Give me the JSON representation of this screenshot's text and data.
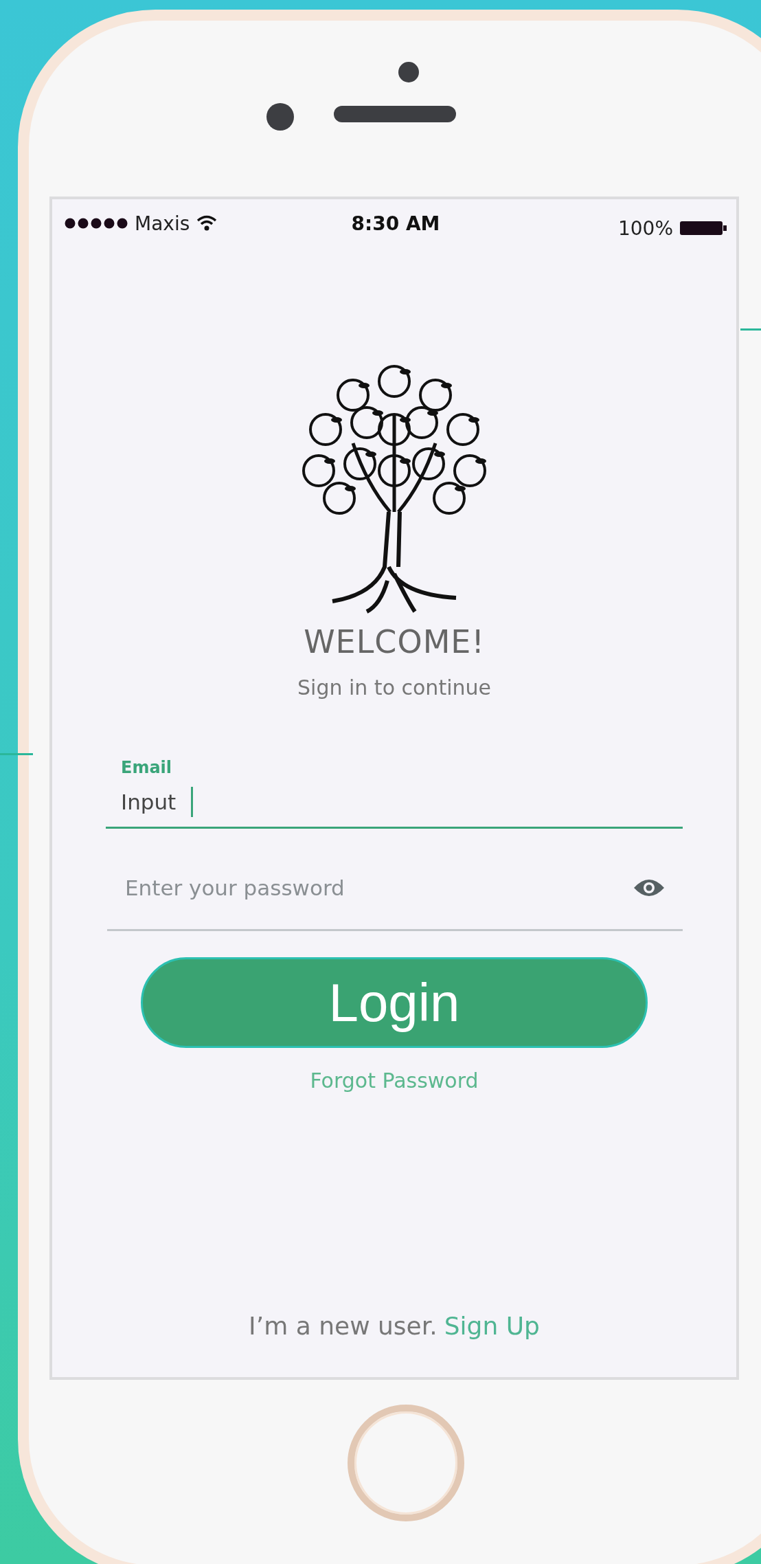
{
  "status_bar": {
    "carrier": "Maxis",
    "time": "8:30 AM",
    "battery": "100%"
  },
  "welcome": {
    "title": "WELCOME!",
    "subtitle": "Sign in to continue"
  },
  "email_field": {
    "label": "Email",
    "value": "Input",
    "focused": true
  },
  "password_field": {
    "placeholder": "Enter your password"
  },
  "login_button": "Login",
  "forgot_password": "Forgot Password",
  "signup": {
    "text": "I’m a new user.",
    "link": "Sign Up"
  }
}
